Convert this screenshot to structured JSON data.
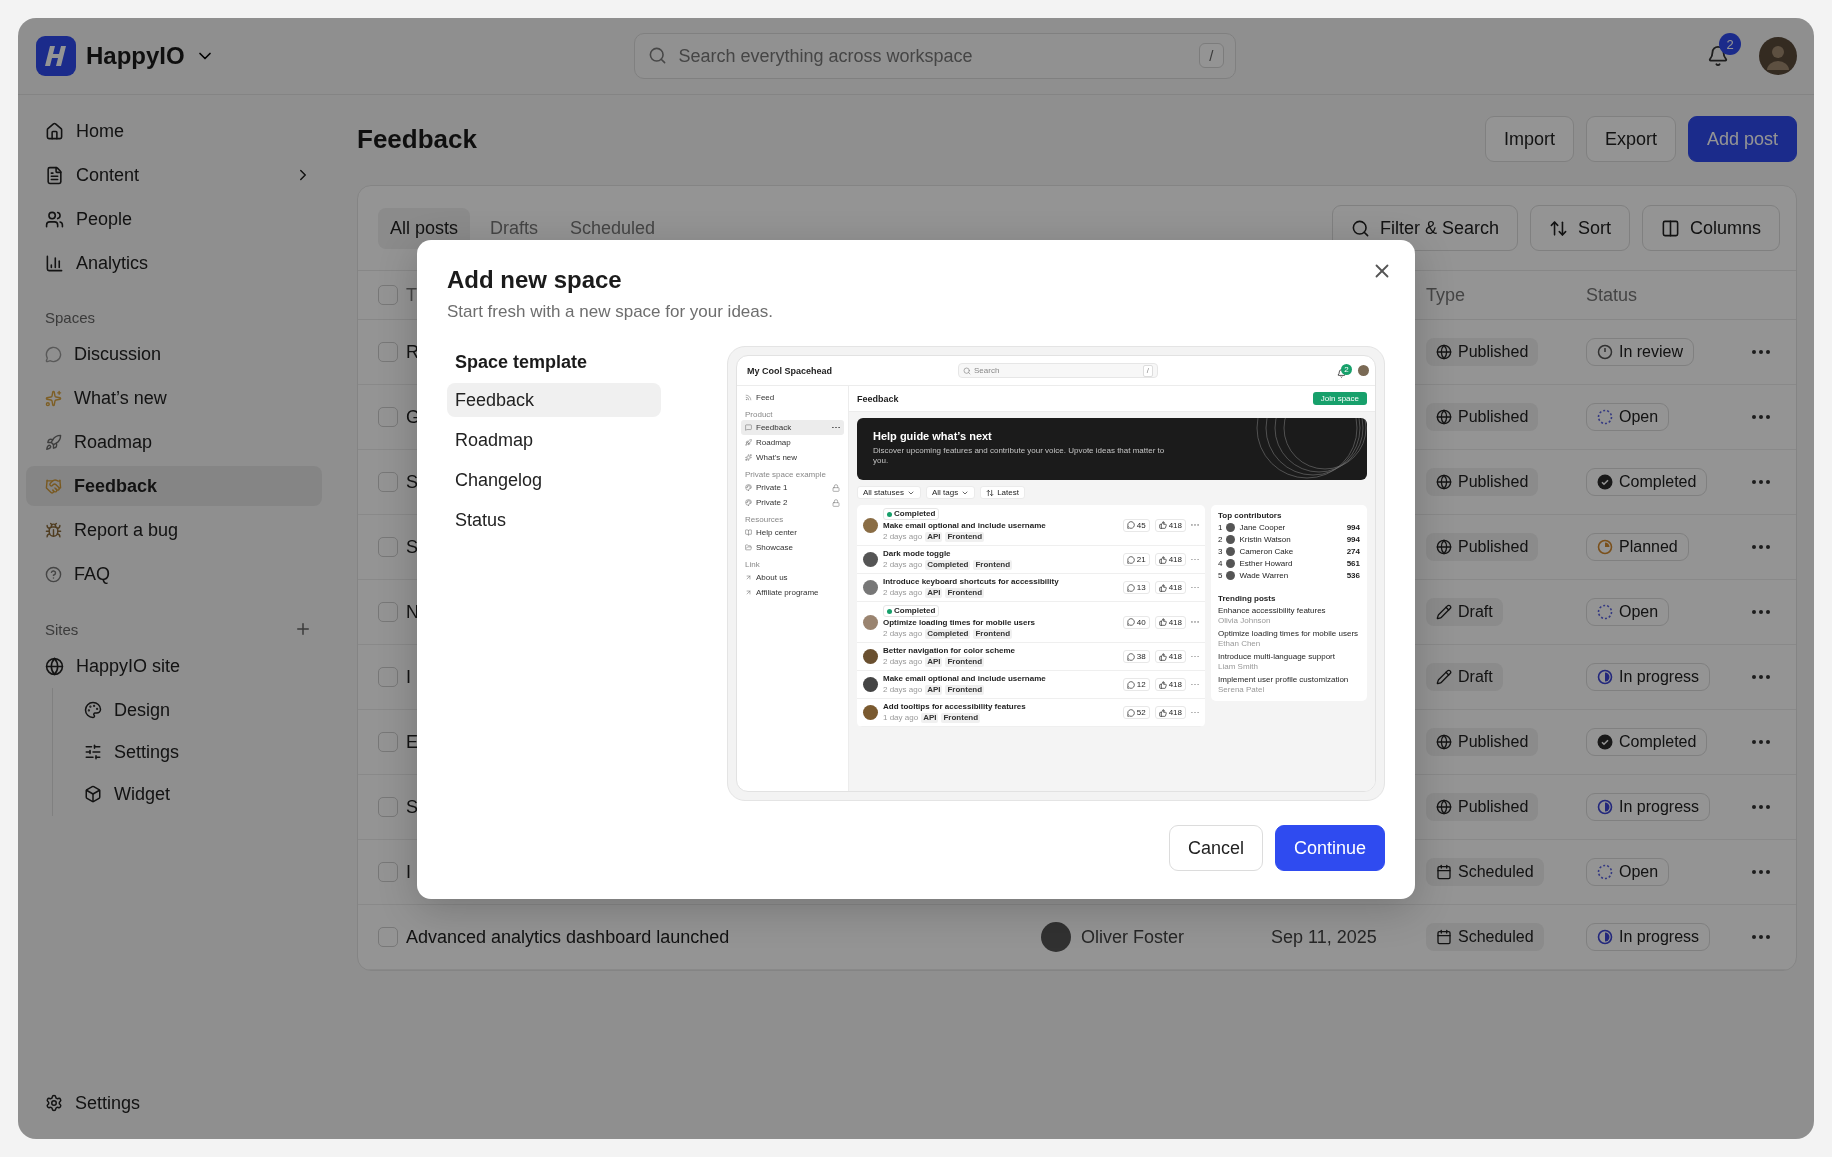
{
  "app": {
    "name": "HappyIO"
  },
  "search": {
    "placeholder": "Search everything across workspace",
    "shortcut": "/"
  },
  "notifications": {
    "count": "2"
  },
  "sidebar": {
    "items": [
      {
        "label": "Home",
        "selected": false
      },
      {
        "label": "Content",
        "selected": false,
        "has_submenu": true
      },
      {
        "label": "People",
        "selected": false
      },
      {
        "label": "Analytics",
        "selected": false
      }
    ],
    "spaces_label": "Spaces",
    "spaces": [
      {
        "label": "Discussion",
        "selected": false
      },
      {
        "label": "What’s new",
        "selected": false
      },
      {
        "label": "Roadmap",
        "selected": false
      },
      {
        "label": "Feedback",
        "selected": true
      },
      {
        "label": "Report a bug",
        "selected": false
      },
      {
        "label": "FAQ",
        "selected": false
      }
    ],
    "sites_label": "Sites",
    "sites": [
      {
        "label": "HappyIO site",
        "children": [
          {
            "label": "Design"
          },
          {
            "label": "Settings"
          },
          {
            "label": "Widget"
          }
        ]
      }
    ],
    "footer": "Settings"
  },
  "page": {
    "title": "Feedback",
    "actions": [
      {
        "label": "Import",
        "kind": "secondary"
      },
      {
        "label": "Export",
        "kind": "secondary"
      },
      {
        "label": "Add post",
        "kind": "primary"
      }
    ]
  },
  "tabs": [
    {
      "label": "All posts",
      "selected": true
    },
    {
      "label": "Drafts",
      "selected": false
    },
    {
      "label": "Scheduled",
      "selected": false
    }
  ],
  "toolbar": [
    "Filter & Search",
    "Sort",
    "Columns"
  ],
  "table": {
    "header_checked": false,
    "columns": [
      "T",
      "Type",
      "Status"
    ],
    "rows": [
      {
        "title": "R",
        "checked": false,
        "type": {
          "label": "Published",
          "kind": "published"
        },
        "status": {
          "label": "In review",
          "kind": "review"
        }
      },
      {
        "title": "G",
        "checked": false,
        "type": {
          "label": "Published",
          "kind": "published"
        },
        "status": {
          "label": "Open",
          "kind": "open"
        }
      },
      {
        "title": "S",
        "checked": false,
        "type": {
          "label": "Published",
          "kind": "published"
        },
        "status": {
          "label": "Completed",
          "kind": "completed"
        }
      },
      {
        "title": "S",
        "checked": false,
        "type": {
          "label": "Published",
          "kind": "published"
        },
        "status": {
          "label": "Planned",
          "kind": "planned"
        }
      },
      {
        "title": "N",
        "checked": false,
        "type": {
          "label": "Draft",
          "kind": "draft"
        },
        "status": {
          "label": "Open",
          "kind": "open"
        }
      },
      {
        "title": "I",
        "checked": false,
        "type": {
          "label": "Draft",
          "kind": "draft"
        },
        "status": {
          "label": "In progress",
          "kind": "progress"
        }
      },
      {
        "title": "E",
        "checked": false,
        "type": {
          "label": "Published",
          "kind": "published"
        },
        "status": {
          "label": "Completed",
          "kind": "completed"
        }
      },
      {
        "title": "S",
        "checked": false,
        "type": {
          "label": "Published",
          "kind": "published"
        },
        "status": {
          "label": "In progress",
          "kind": "progress"
        }
      },
      {
        "title": "I",
        "checked": false,
        "type": {
          "label": "Scheduled",
          "kind": "scheduled"
        },
        "status": {
          "label": "Open",
          "kind": "open"
        }
      },
      {
        "title": "Advanced analytics dashboard launched",
        "author": "Oliver Foster",
        "date": "Sep 11, 2025",
        "checked": false,
        "type": {
          "label": "Scheduled",
          "kind": "scheduled"
        },
        "status": {
          "label": "In progress",
          "kind": "progress"
        }
      }
    ]
  },
  "modal": {
    "title": "Add new space",
    "subtitle": "Start fresh with a new space for your ideas.",
    "templates_label": "Space template",
    "templates": [
      {
        "label": "Feedback",
        "selected": true
      },
      {
        "label": "Roadmap",
        "selected": false
      },
      {
        "label": "Changelog",
        "selected": false
      },
      {
        "label": "Status",
        "selected": false
      }
    ],
    "preview": {
      "title": "My Cool Spacehead",
      "search_placeholder": "Search",
      "shortcut": "/",
      "notification_count": "2",
      "nav": [
        {
          "kind": "item",
          "label": "Feed",
          "selected": false
        },
        {
          "kind": "heading",
          "label": "Product"
        },
        {
          "kind": "item",
          "label": "Feedback",
          "selected": true
        },
        {
          "kind": "item",
          "label": "Roadmap",
          "selected": false
        },
        {
          "kind": "item",
          "label": "What's new",
          "selected": false
        },
        {
          "kind": "heading",
          "label": "Private space example"
        },
        {
          "kind": "item",
          "label": "Private 1",
          "selected": false,
          "locked": true
        },
        {
          "kind": "item",
          "label": "Private 2",
          "selected": false,
          "locked": true
        },
        {
          "kind": "heading",
          "label": "Resources"
        },
        {
          "kind": "item",
          "label": "Help center",
          "selected": false
        },
        {
          "kind": "item",
          "label": "Showcase",
          "selected": false
        },
        {
          "kind": "heading",
          "label": "Link"
        },
        {
          "kind": "item",
          "label": "About us",
          "selected": false
        },
        {
          "kind": "item",
          "label": "Affiliate programe",
          "selected": false
        }
      ],
      "page_title": "Feedback",
      "join": "Join space",
      "hero": {
        "title": "Help guide what’s next",
        "text": "Discover upcoming features and contribute your voice. Upvote ideas that matter to you."
      },
      "filters": [
        {
          "label": "All statuses",
          "kind": "dropdown"
        },
        {
          "label": "All tags",
          "kind": "dropdown"
        },
        {
          "label": "Latest",
          "kind": "sort"
        }
      ],
      "posts": [
        {
          "badge": "Completed",
          "title": "Make email optional and include username",
          "age": "2 days ago",
          "tags": [
            "API",
            "Frontend"
          ],
          "comments": "45",
          "votes": "418"
        },
        {
          "title": "Dark mode toggle",
          "age": "2 days ago",
          "tags": [
            "Completed",
            "Frontend"
          ],
          "comments": "21",
          "votes": "418"
        },
        {
          "title": "Introduce keyboard shortcuts for accessibility",
          "age": "2 days ago",
          "tags": [
            "API",
            "Frontend"
          ],
          "comments": "13",
          "votes": "418"
        },
        {
          "badge": "Completed",
          "title": "Optimize loading times for mobile users",
          "age": "2 days ago",
          "tags": [
            "Completed",
            "Frontend"
          ],
          "comments": "40",
          "votes": "418"
        },
        {
          "title": "Better navigation for color scheme",
          "age": "2 days ago",
          "tags": [
            "API",
            "Frontend"
          ],
          "comments": "38",
          "votes": "418"
        },
        {
          "title": "Make email optional and include username",
          "age": "2 days ago",
          "tags": [
            "API",
            "Frontend"
          ],
          "comments": "12",
          "votes": "418"
        },
        {
          "title": "Add tooltips for accessibility features",
          "age": "1 day ago",
          "tags": [
            "API",
            "Frontend"
          ],
          "comments": "52",
          "votes": "418"
        }
      ],
      "contributors": {
        "title": "Top contributors",
        "items": [
          {
            "rank": "1",
            "name": "Jane Cooper",
            "score": "994"
          },
          {
            "rank": "2",
            "name": "Kristin Watson",
            "score": "994"
          },
          {
            "rank": "3",
            "name": "Cameron Cake",
            "score": "274"
          },
          {
            "rank": "4",
            "name": "Esther Howard",
            "score": "561"
          },
          {
            "rank": "5",
            "name": "Wade Warren",
            "score": "536"
          }
        ]
      },
      "trending": {
        "title": "Trending posts",
        "items": [
          {
            "title": "Enhance accessibility features",
            "author": "Olivia Johnson"
          },
          {
            "title": "Optimize loading times for mobile users",
            "author": "Ethan Chen"
          },
          {
            "title": "Introduce multi-language support",
            "author": "Liam Smith"
          },
          {
            "title": "Implement user profile customization",
            "author": "Serena Patel"
          }
        ]
      }
    },
    "buttons": [
      {
        "label": "Cancel",
        "kind": "secondary"
      },
      {
        "label": "Continue",
        "kind": "primary"
      }
    ]
  }
}
